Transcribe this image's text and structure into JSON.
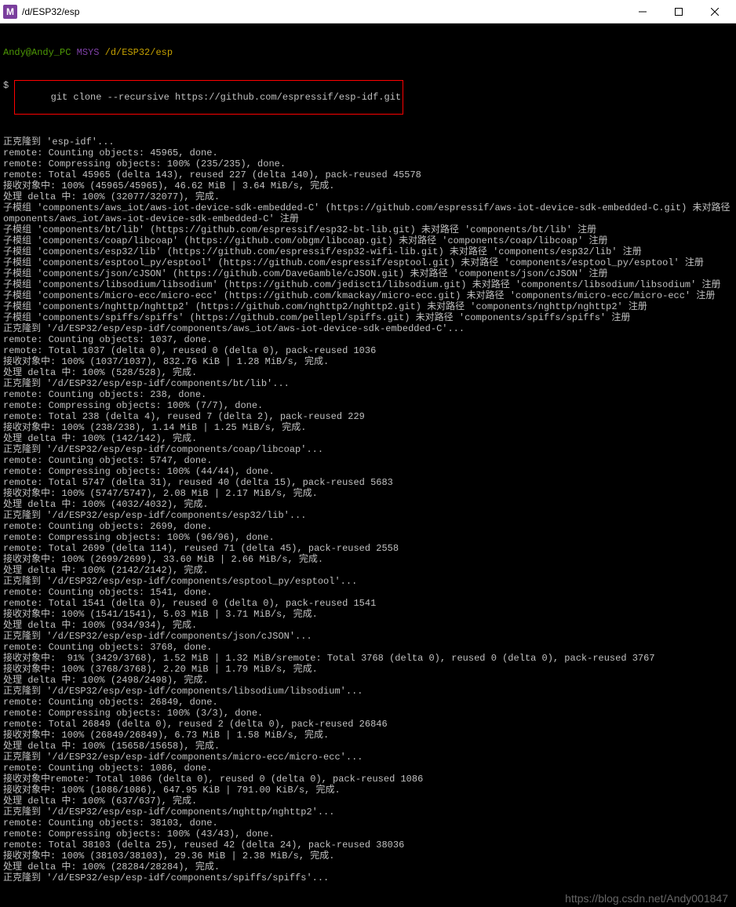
{
  "window": {
    "icon_letter": "M",
    "title": "/d/ESP32/esp"
  },
  "prompt": {
    "user": "Andy@Andy_PC",
    "sys": "MSYS",
    "path": "/d/ESP32/esp",
    "dollar": "$",
    "command": "git clone --recursive https://github.com/espressif/esp-idf.git"
  },
  "lines": [
    "正克隆到 'esp-idf'...",
    "remote: Counting objects: 45965, done.",
    "remote: Compressing objects: 100% (235/235), done.",
    "remote: Total 45965 (delta 143), reused 227 (delta 140), pack-reused 45578",
    "接收对象中: 100% (45965/45965), 46.62 MiB | 3.64 MiB/s, 完成.",
    "处理 delta 中: 100% (32077/32077), 完成.",
    "子模组 'components/aws_iot/aws-iot-device-sdk-embedded-C' (https://github.com/espressif/aws-iot-device-sdk-embedded-C.git) 未对路径 'c",
    "omponents/aws_iot/aws-iot-device-sdk-embedded-C' 注册",
    "子模组 'components/bt/lib' (https://github.com/espressif/esp32-bt-lib.git) 未对路径 'components/bt/lib' 注册",
    "子模组 'components/coap/libcoap' (https://github.com/obgm/libcoap.git) 未对路径 'components/coap/libcoap' 注册",
    "子模组 'components/esp32/lib' (https://github.com/espressif/esp32-wifi-lib.git) 未对路径 'components/esp32/lib' 注册",
    "子模组 'components/esptool_py/esptool' (https://github.com/espressif/esptool.git) 未对路径 'components/esptool_py/esptool' 注册",
    "子模组 'components/json/cJSON' (https://github.com/DaveGamble/cJSON.git) 未对路径 'components/json/cJSON' 注册",
    "子模组 'components/libsodium/libsodium' (https://github.com/jedisct1/libsodium.git) 未对路径 'components/libsodium/libsodium' 注册",
    "子模组 'components/micro-ecc/micro-ecc' (https://github.com/kmackay/micro-ecc.git) 未对路径 'components/micro-ecc/micro-ecc' 注册",
    "子模组 'components/nghttp/nghttp2' (https://github.com/nghttp2/nghttp2.git) 未对路径 'components/nghttp/nghttp2' 注册",
    "子模组 'components/spiffs/spiffs' (https://github.com/pellepl/spiffs.git) 未对路径 'components/spiffs/spiffs' 注册",
    "正克隆到 '/d/ESP32/esp/esp-idf/components/aws_iot/aws-iot-device-sdk-embedded-C'...",
    "remote: Counting objects: 1037, done.",
    "remote: Total 1037 (delta 0), reused 0 (delta 0), pack-reused 1036",
    "接收对象中: 100% (1037/1037), 832.76 KiB | 1.28 MiB/s, 完成.",
    "处理 delta 中: 100% (528/528), 完成.",
    "正克隆到 '/d/ESP32/esp/esp-idf/components/bt/lib'...",
    "remote: Counting objects: 238, done.",
    "remote: Compressing objects: 100% (7/7), done.",
    "remote: Total 238 (delta 4), reused 7 (delta 2), pack-reused 229",
    "接收对象中: 100% (238/238), 1.14 MiB | 1.25 MiB/s, 完成.",
    "处理 delta 中: 100% (142/142), 完成.",
    "正克隆到 '/d/ESP32/esp/esp-idf/components/coap/libcoap'...",
    "remote: Counting objects: 5747, done.",
    "remote: Compressing objects: 100% (44/44), done.",
    "remote: Total 5747 (delta 31), reused 40 (delta 15), pack-reused 5683",
    "接收对象中: 100% (5747/5747), 2.08 MiB | 2.17 MiB/s, 完成.",
    "处理 delta 中: 100% (4032/4032), 完成.",
    "正克隆到 '/d/ESP32/esp/esp-idf/components/esp32/lib'...",
    "remote: Counting objects: 2699, done.",
    "remote: Compressing objects: 100% (96/96), done.",
    "remote: Total 2699 (delta 114), reused 71 (delta 45), pack-reused 2558",
    "接收对象中: 100% (2699/2699), 33.60 MiB | 2.66 MiB/s, 完成.",
    "处理 delta 中: 100% (2142/2142), 完成.",
    "正克隆到 '/d/ESP32/esp/esp-idf/components/esptool_py/esptool'...",
    "remote: Counting objects: 1541, done.",
    "remote: Total 1541 (delta 0), reused 0 (delta 0), pack-reused 1541",
    "接收对象中: 100% (1541/1541), 5.03 MiB | 3.71 MiB/s, 完成.",
    "处理 delta 中: 100% (934/934), 完成.",
    "正克隆到 '/d/ESP32/esp/esp-idf/components/json/cJSON'...",
    "remote: Counting objects: 3768, done.",
    "接收对象中:  91% (3429/3768), 1.52 MiB | 1.32 MiB/sremote: Total 3768 (delta 0), reused 0 (delta 0), pack-reused 3767",
    "接收对象中: 100% (3768/3768), 2.20 MiB | 1.79 MiB/s, 完成.",
    "处理 delta 中: 100% (2498/2498), 完成.",
    "正克隆到 '/d/ESP32/esp/esp-idf/components/libsodium/libsodium'...",
    "remote: Counting objects: 26849, done.",
    "remote: Compressing objects: 100% (3/3), done.",
    "remote: Total 26849 (delta 0), reused 2 (delta 0), pack-reused 26846",
    "接收对象中: 100% (26849/26849), 6.73 MiB | 1.58 MiB/s, 完成.",
    "处理 delta 中: 100% (15658/15658), 完成.",
    "正克隆到 '/d/ESP32/esp/esp-idf/components/micro-ecc/micro-ecc'...",
    "remote: Counting objects: 1086, done.",
    "接收对象中remote: Total 1086 (delta 0), reused 0 (delta 0), pack-reused 1086",
    "接收对象中: 100% (1086/1086), 647.95 KiB | 791.00 KiB/s, 完成.",
    "处理 delta 中: 100% (637/637), 完成.",
    "正克隆到 '/d/ESP32/esp/esp-idf/components/nghttp/nghttp2'...",
    "remote: Counting objects: 38103, done.",
    "remote: Compressing objects: 100% (43/43), done.",
    "remote: Total 38103 (delta 25), reused 42 (delta 24), pack-reused 38036",
    "接收对象中: 100% (38103/38103), 29.36 MiB | 2.38 MiB/s, 完成.",
    "处理 delta 中: 100% (28284/28284), 完成.",
    "正克隆到 '/d/ESP32/esp/esp-idf/components/spiffs/spiffs'..."
  ],
  "watermark": "https://blog.csdn.net/Andy001847"
}
